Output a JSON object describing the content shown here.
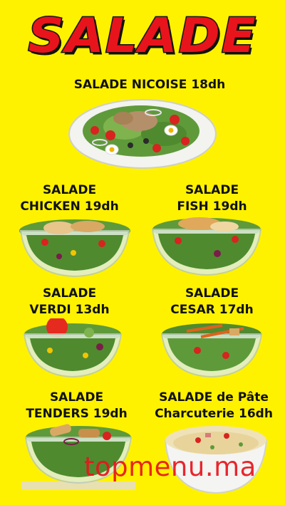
{
  "title": "SALADE",
  "items": [
    {
      "label": "SALADE NICOISE 18dh"
    },
    {
      "label": "SALADE\nCHICKEN 19dh"
    },
    {
      "label": "SALADE\nFISH 19dh"
    },
    {
      "label": "SALADE\nVERDI 13dh"
    },
    {
      "label": "SALADE\nCESAR 17dh"
    },
    {
      "label": "SALADE\nTENDERS 19dh"
    },
    {
      "label": "SALADE de Pâte\nCharcuterie 16dh"
    }
  ],
  "watermark": "topmenu.ma",
  "colors": {
    "background": "#fff200",
    "title": "#e8141c",
    "watermark": "#e8141c"
  }
}
